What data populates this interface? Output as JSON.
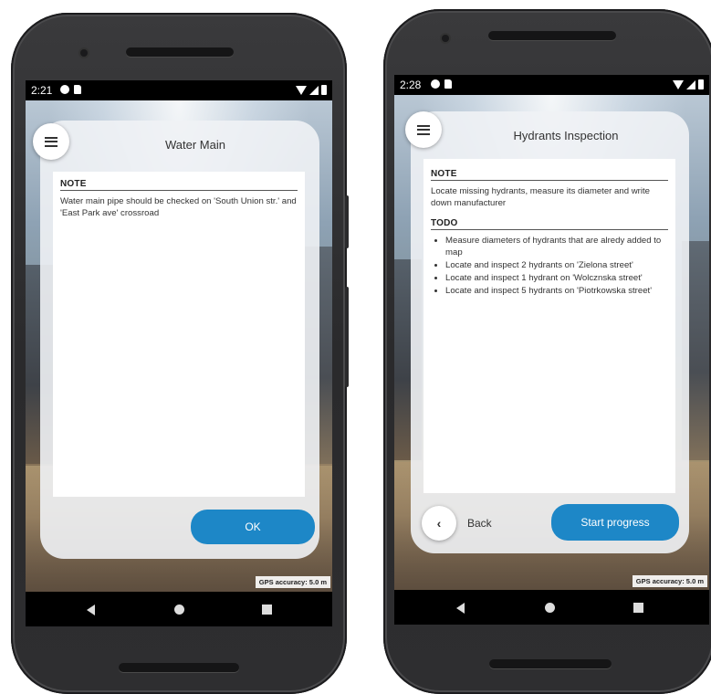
{
  "left_phone": {
    "status": {
      "time": "2:21"
    },
    "header": {
      "title": "Water Main"
    },
    "note": {
      "heading": "NOTE",
      "text": "Water main pipe should be checked on 'South Union str.' and 'East Park ave' crossroad"
    },
    "actions": {
      "ok_label": "OK"
    },
    "gps_label": "GPS accuracy: 5.0 m"
  },
  "right_phone": {
    "status": {
      "time": "2:28"
    },
    "header": {
      "title": "Hydrants Inspection"
    },
    "note": {
      "heading": "NOTE",
      "text": "Locate missing hydrants, measure its diameter and write down manufacturer"
    },
    "todo": {
      "heading": "TODO",
      "items": [
        "Measure diameters of hydrants that are alredy added to map",
        "Locate and inspect 2 hydrants on 'Zielona street'",
        "Locate and inspect 1 hydrant on 'Wolcznska street'",
        "Locate and inspect 5 hydrants on 'Piotrkowska street'"
      ]
    },
    "actions": {
      "back_label": "Back",
      "start_label": "Start progress"
    },
    "gps_label": "GPS accuracy: 5.0 m"
  },
  "icons": {
    "menu": "hamburger-menu-icon",
    "back": "chevron-left-icon",
    "nav_back": "triangle-back-icon",
    "nav_home": "circle-home-icon",
    "nav_recents": "square-recents-icon"
  },
  "colors": {
    "primary": "#1d87c7",
    "card": "#f0f2f5",
    "phone_body": "#2e2e30"
  }
}
